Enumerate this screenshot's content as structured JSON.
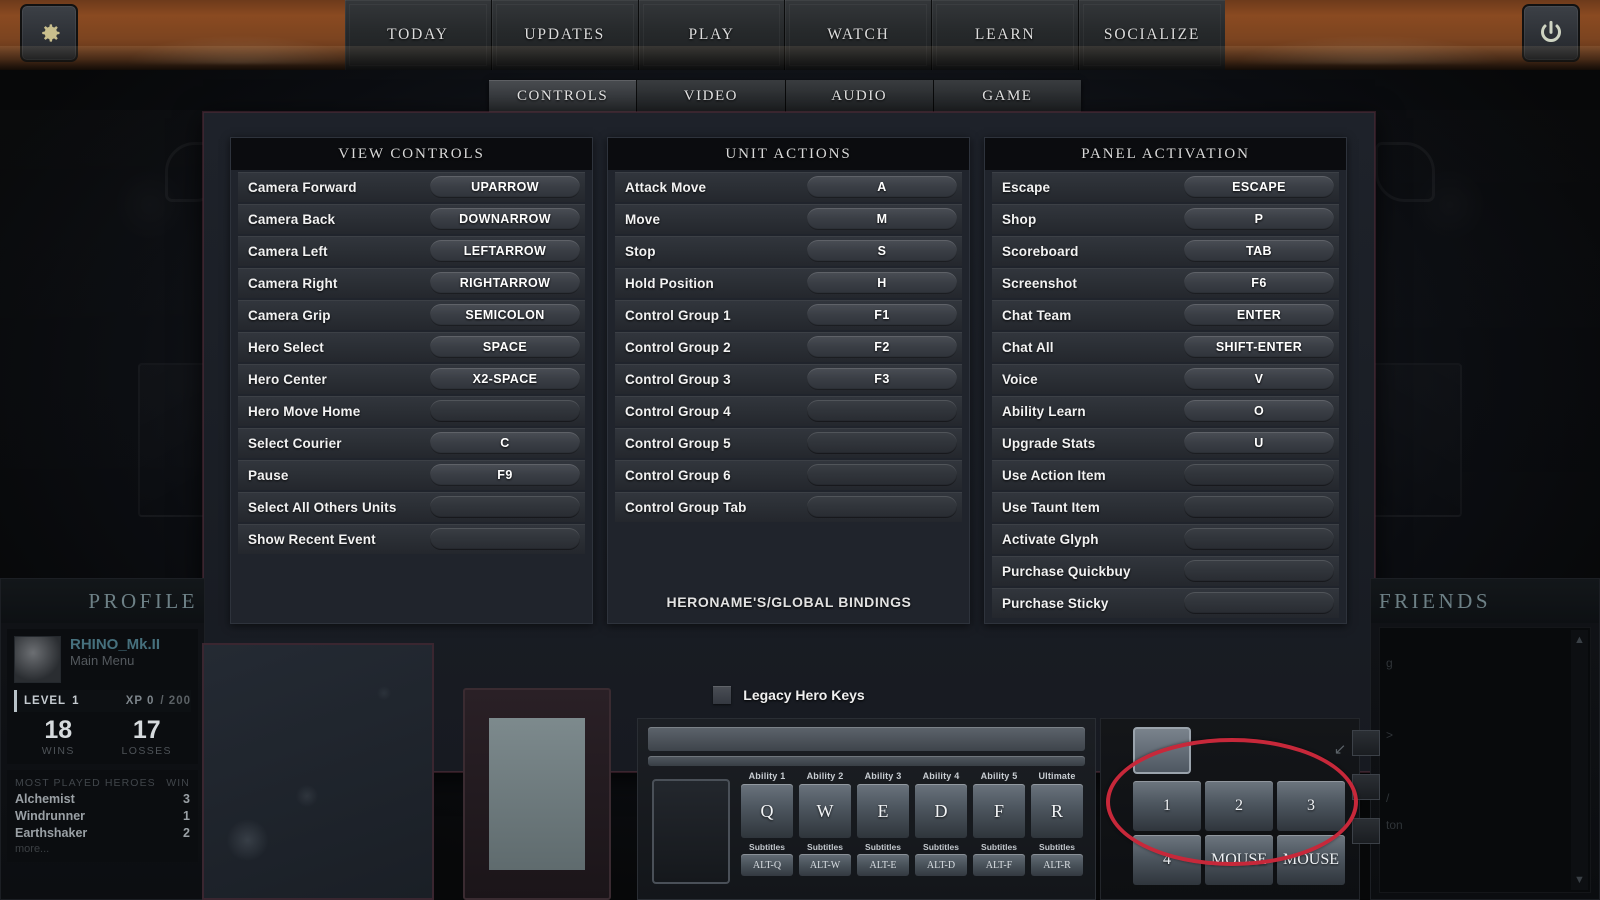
{
  "topbar": {
    "gear_icon": "gear-icon",
    "power_icon": "power-icon",
    "nav": [
      {
        "label": "TODAY"
      },
      {
        "label": "UPDATES"
      },
      {
        "label": "PLAY"
      },
      {
        "label": "WATCH"
      },
      {
        "label": "LEARN"
      },
      {
        "label": "SOCIALIZE"
      }
    ]
  },
  "tabs": [
    {
      "label": "CONTROLS",
      "active": true
    },
    {
      "label": "VIDEO",
      "active": false
    },
    {
      "label": "AUDIO",
      "active": false
    },
    {
      "label": "GAME",
      "active": false
    }
  ],
  "settings": {
    "columns": [
      {
        "title": "VIEW CONTROLS",
        "rows": [
          {
            "label": "Camera Forward",
            "key": "UPARROW"
          },
          {
            "label": "Camera Back",
            "key": "DOWNARROW"
          },
          {
            "label": "Camera Left",
            "key": "LEFTARROW"
          },
          {
            "label": "Camera Right",
            "key": "RIGHTARROW"
          },
          {
            "label": "Camera Grip",
            "key": "SEMICOLON"
          },
          {
            "label": "Hero Select",
            "key": "SPACE"
          },
          {
            "label": "Hero Center",
            "key": "X2-SPACE"
          },
          {
            "label": "Hero Move Home",
            "key": ""
          },
          {
            "label": "Select Courier",
            "key": "C"
          },
          {
            "label": "Pause",
            "key": "F9"
          },
          {
            "label": "Select All Others Units",
            "key": ""
          },
          {
            "label": "Show Recent Event",
            "key": ""
          }
        ]
      },
      {
        "title": "UNIT ACTIONS",
        "rows": [
          {
            "label": "Attack Move",
            "key": "A"
          },
          {
            "label": "Move",
            "key": "M"
          },
          {
            "label": "Stop",
            "key": "S"
          },
          {
            "label": "Hold Position",
            "key": "H"
          },
          {
            "label": "Control Group 1",
            "key": "F1"
          },
          {
            "label": "Control Group 2",
            "key": "F2"
          },
          {
            "label": "Control Group 3",
            "key": "F3"
          },
          {
            "label": "Control Group 4",
            "key": ""
          },
          {
            "label": "Control Group 5",
            "key": ""
          },
          {
            "label": "Control Group 6",
            "key": ""
          },
          {
            "label": "Control Group Tab",
            "key": ""
          }
        ]
      },
      {
        "title": "PANEL ACTIVATION",
        "rows": [
          {
            "label": "Escape",
            "key": "ESCAPE"
          },
          {
            "label": "Shop",
            "key": "P"
          },
          {
            "label": "Scoreboard",
            "key": "TAB"
          },
          {
            "label": "Screenshot",
            "key": "F6"
          },
          {
            "label": "Chat Team",
            "key": "ENTER"
          },
          {
            "label": "Chat All",
            "key": "SHIFT-ENTER"
          },
          {
            "label": "Voice",
            "key": "V"
          },
          {
            "label": "Ability Learn",
            "key": "O"
          },
          {
            "label": "Upgrade Stats",
            "key": "U"
          },
          {
            "label": "Use Action Item",
            "key": ""
          },
          {
            "label": "Use Taunt Item",
            "key": ""
          },
          {
            "label": "Activate Glyph",
            "key": ""
          },
          {
            "label": "Purchase Quickbuy",
            "key": ""
          },
          {
            "label": "Purchase Sticky",
            "key": ""
          }
        ]
      }
    ],
    "bindings_label": "HERONAME'S/GLOBAL BINDINGS",
    "legacy_hero_keys": {
      "label": "Legacy Hero Keys",
      "checked": false
    }
  },
  "profile": {
    "title": "PROFILE",
    "player_name": "RHINO_Mk.II",
    "status": "Main Menu",
    "level_label": "LEVEL",
    "level_value": "1",
    "xp_label": "XP 0",
    "xp_max": "/ 200",
    "wins_value": "18",
    "wins_label": "WINS",
    "losses_value": "17",
    "losses_label": "LOSSES",
    "most_played_header": "MOST PLAYED HEROES",
    "wins_column_header": "WIN",
    "heroes": [
      {
        "name": "Alchemist",
        "wins": "3"
      },
      {
        "name": "Windrunner",
        "wins": "1"
      },
      {
        "name": "Earthshaker",
        "wins": "2"
      }
    ],
    "more_label": "more..."
  },
  "friends": {
    "title": "FRIENDS",
    "fragment_1": "g",
    "fragment_2": ">",
    "fragment_3": "/",
    "fragment_4": "ton",
    "scroll_up": "▲",
    "scroll_down": "▼"
  },
  "hud": {
    "abilities": [
      {
        "caption": "Ability 1",
        "key": "Q",
        "sub_caption": "Subtitles",
        "sub_key": "ALT-Q"
      },
      {
        "caption": "Ability 2",
        "key": "W",
        "sub_caption": "Subtitles",
        "sub_key": "ALT-W"
      },
      {
        "caption": "Ability 3",
        "key": "E",
        "sub_caption": "Subtitles",
        "sub_key": "ALT-E"
      },
      {
        "caption": "Ability 4",
        "key": "D",
        "sub_caption": "Subtitles",
        "sub_key": "ALT-D"
      },
      {
        "caption": "Ability 5",
        "key": "F",
        "sub_caption": "Subtitles",
        "sub_key": "ALT-F"
      },
      {
        "caption": "Ultimate",
        "key": "R",
        "sub_caption": "Subtitles",
        "sub_key": "ALT-R"
      }
    ],
    "items": [
      {
        "key": "1"
      },
      {
        "key": "2"
      },
      {
        "key": "3"
      },
      {
        "key": "4"
      },
      {
        "key": "MOUSE"
      },
      {
        "key": "MOUSE"
      }
    ],
    "stash_arrow": "↙"
  },
  "annotation": {
    "highlight_color": "#c7283a",
    "shape": "ellipse"
  }
}
